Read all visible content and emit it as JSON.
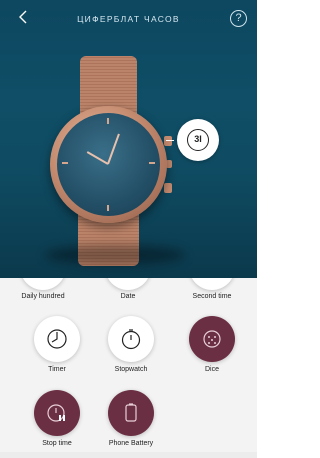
{
  "header": {
    "title": "ЦИФЕРБЛАТ ЧАСОВ",
    "back_icon": "chevron-left-icon",
    "help_label": "?"
  },
  "watch": {
    "callout_text": "3I"
  },
  "colors": {
    "header_bg": "#0f4e66",
    "selected_circle": "#6b2f43",
    "grid_bg": "#f3f3f3",
    "accent_rose_gold": "#c58c70"
  },
  "functions": [
    {
      "label": "Daily hundred",
      "icon": "daily-hundred-icon",
      "selected": false
    },
    {
      "label": "Date",
      "icon": "date-icon",
      "selected": false
    },
    {
      "label": "Second time",
      "icon": "second-time-icon",
      "selected": false
    },
    {
      "label": "Timer",
      "icon": "timer-icon",
      "selected": false
    },
    {
      "label": "Stopwatch",
      "icon": "stopwatch-icon",
      "selected": false
    },
    {
      "label": "Dice",
      "icon": "dice-icon",
      "selected": true
    },
    {
      "label": "Stop time",
      "icon": "stop-time-icon",
      "selected": true
    },
    {
      "label": "Phone Battery",
      "icon": "phone-battery-icon",
      "selected": true
    }
  ]
}
